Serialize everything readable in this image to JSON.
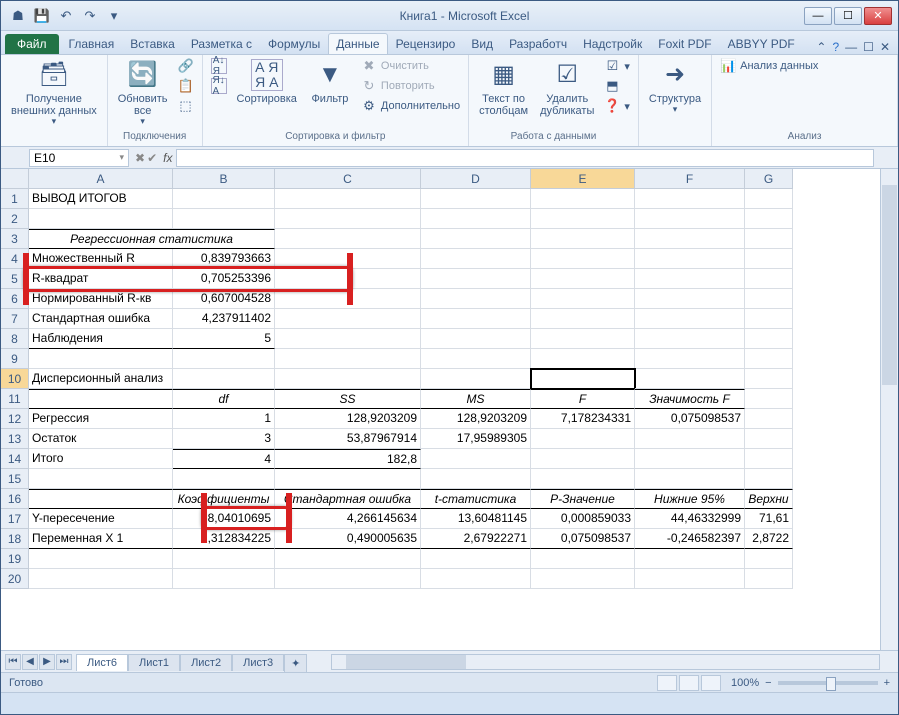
{
  "window": {
    "title": "Книга1 - Microsoft Excel"
  },
  "tabs": {
    "file": "Файл",
    "items": [
      "Главная",
      "Вставка",
      "Разметка с",
      "Формулы",
      "Данные",
      "Рецензиро",
      "Вид",
      "Разработч",
      "Надстройк",
      "Foxit PDF",
      "ABBYY PDF"
    ],
    "active_index": 4
  },
  "ribbon": {
    "groups": {
      "external": {
        "btn": "Получение\nвнешних данных",
        "label": ""
      },
      "connections": {
        "refresh": "Обновить\nвсе",
        "label": "Подключения"
      },
      "sortfilter": {
        "sort": "Сортировка",
        "filter": "Фильтр",
        "clear": "Очистить",
        "reapply": "Повторить",
        "advanced": "Дополнительно",
        "label": "Сортировка и фильтр"
      },
      "datatools": {
        "textcol": "Текст по\nстолбцам",
        "dedup": "Удалить\nдубликаты",
        "label": "Работа с данными"
      },
      "outline": {
        "btn": "Структура",
        "label": ""
      },
      "analysis": {
        "btn": "Анализ данных",
        "label": "Анализ"
      }
    }
  },
  "namebox": "E10",
  "columns": [
    "A",
    "B",
    "C",
    "D",
    "E",
    "F",
    "G"
  ],
  "colWidths": [
    "cw-A",
    "cw-B",
    "cw-C",
    "cw-D",
    "cw-E",
    "cw-F",
    "cw-G"
  ],
  "cells": {
    "r1": {
      "A": "ВЫВОД ИТОГОВ"
    },
    "r3": {
      "A": "Регрессионная статистика"
    },
    "r4": {
      "A": "Множественный R",
      "B": "0,839793663"
    },
    "r5": {
      "A": "R-квадрат",
      "B": "0,705253396"
    },
    "r6": {
      "A": "Нормированный R-кв",
      "B": "0,607004528"
    },
    "r7": {
      "A": "Стандартная ошибка",
      "B": "4,237911402"
    },
    "r8": {
      "A": "Наблюдения",
      "B": "5"
    },
    "r10": {
      "A": "Дисперсионный анализ"
    },
    "r11": {
      "B": "df",
      "C": "SS",
      "D": "MS",
      "E": "F",
      "F": "Значимость F"
    },
    "r12": {
      "A": "Регрессия",
      "B": "1",
      "C": "128,9203209",
      "D": "128,9203209",
      "E": "7,178234331",
      "F": "0,075098537"
    },
    "r13": {
      "A": "Остаток",
      "B": "3",
      "C": "53,87967914",
      "D": "17,95989305"
    },
    "r14": {
      "A": "Итого",
      "B": "4",
      "C": "182,8"
    },
    "r16": {
      "B": "Коэффициенты",
      "C": "Стандартная ошибка",
      "D": "t-статистика",
      "E": "P-Значение",
      "F": "Нижние 95%",
      "G": "Верхни"
    },
    "r17": {
      "A": "Y-пересечение",
      "B": "58,04010695",
      "C": "4,266145634",
      "D": "13,60481145",
      "E": "0,000859033",
      "F": "44,46332999",
      "G": "71,61"
    },
    "r18": {
      "A": "Переменная X 1",
      "B": "1,312834225",
      "C": "0,490005635",
      "D": "2,67922271",
      "E": "0,075098537",
      "F": "-0,246582397",
      "G": "2,8722"
    }
  },
  "sheets": {
    "active": "Лист6",
    "others": [
      "Лист1",
      "Лист2",
      "Лист3"
    ]
  },
  "status": {
    "ready": "Готово",
    "zoom": "100%"
  }
}
